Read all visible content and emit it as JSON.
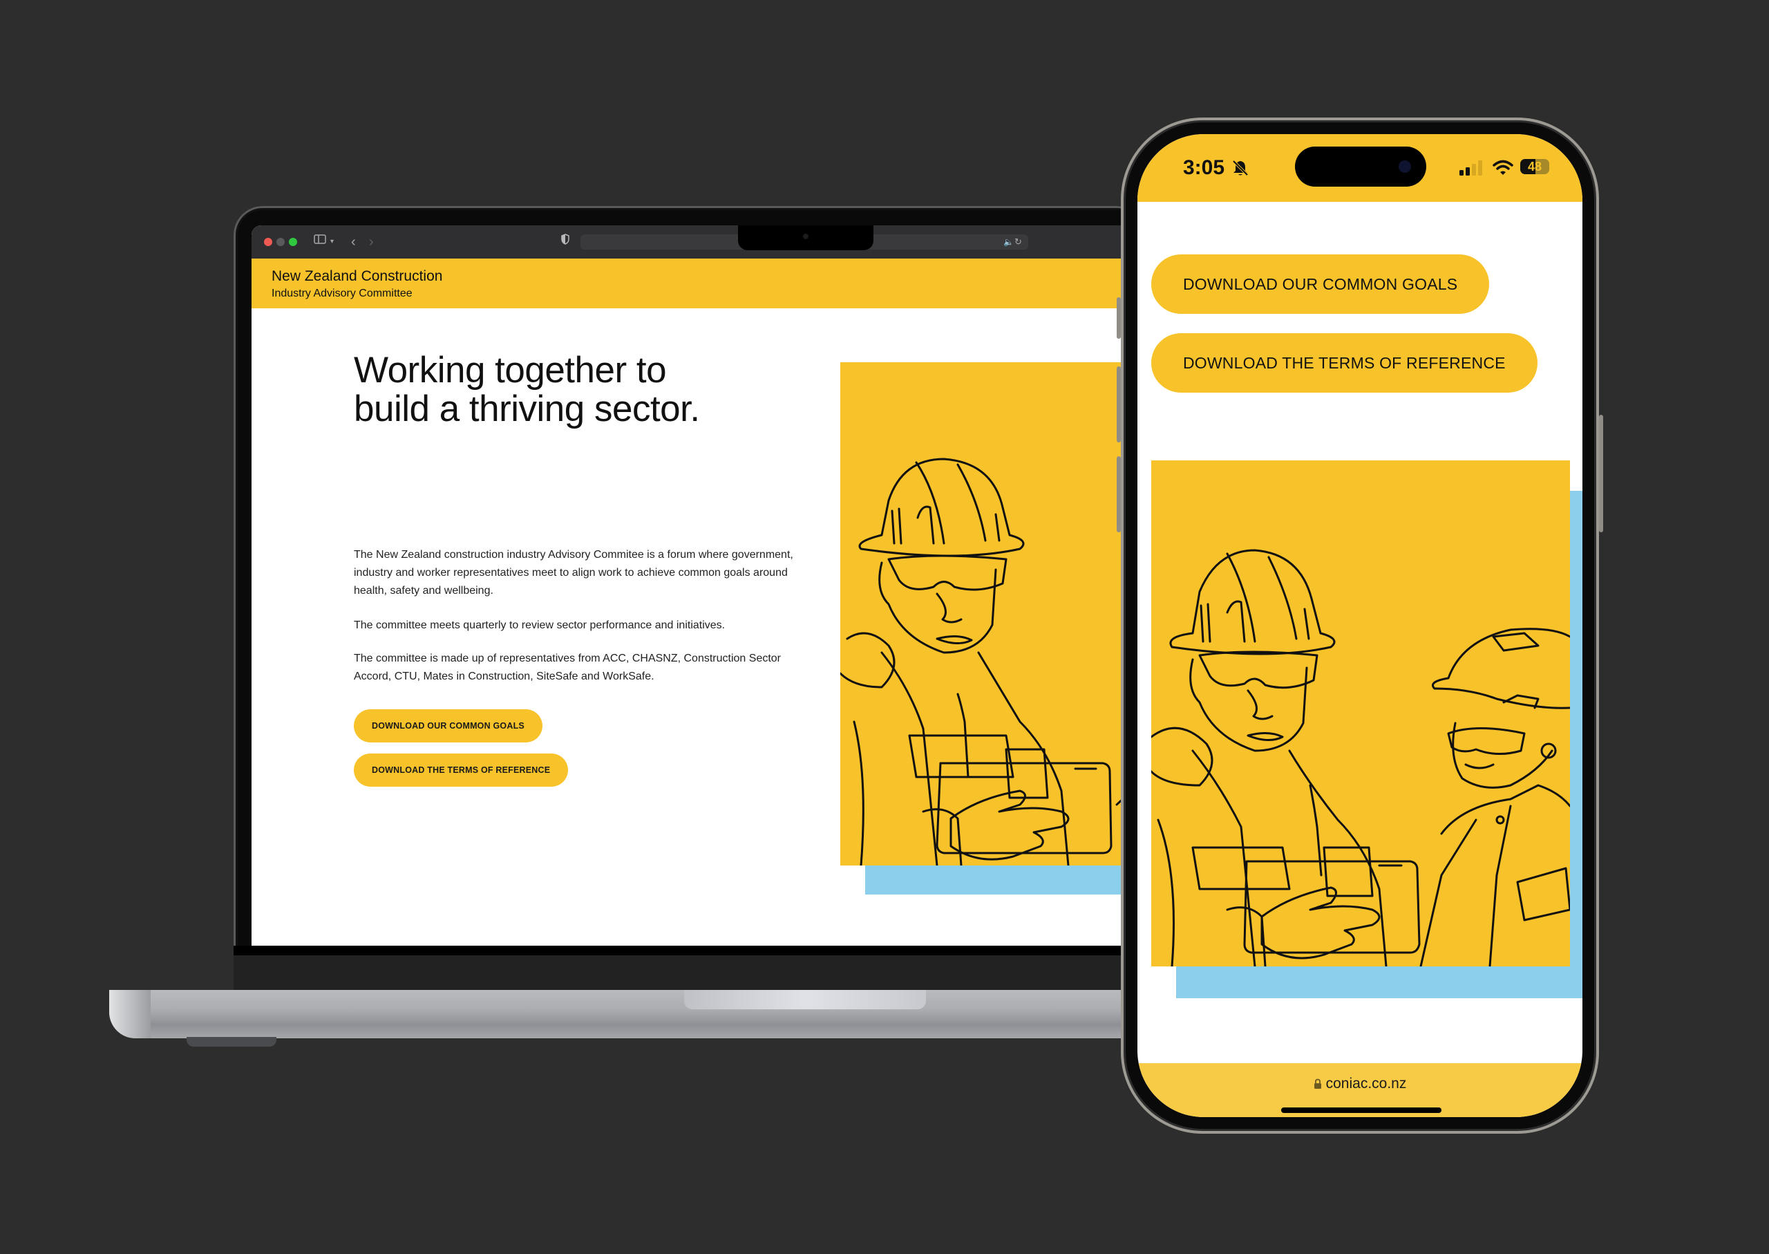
{
  "colors": {
    "brand_yellow": "#f7c22a",
    "accent_blue": "#8ccfec",
    "background": "#2d2d2d",
    "text": "#111111"
  },
  "laptop": {
    "browser": {
      "icons": [
        "close-dot",
        "minimize-dot",
        "zoom-dot",
        "sidebar-icon",
        "chevron-down-icon",
        "back-icon",
        "forward-icon",
        "shield-icon",
        "audio-icon",
        "reload-icon"
      ]
    },
    "header": {
      "title": "New Zealand Construction",
      "subtitle": "Industry Advisory Committee"
    },
    "hero": {
      "heading_line1": "Working together to",
      "heading_line2": "build a thriving sector.",
      "paragraphs": [
        "The New Zealand construction industry Advisory Commitee is a forum where government, industry and worker representatives meet to align work to achieve common goals around health, safety and wellbeing.",
        "The committee meets quarterly to review sector performance and initiatives.",
        "The committee is made up of representatives from ACC, CHASNZ, Construction Sector Accord, CTU, Mates in Construction, SiteSafe and WorkSafe."
      ],
      "buttons": [
        {
          "label": "DOWNLOAD OUR COMMON GOALS"
        },
        {
          "label": "DOWNLOAD THE TERMS OF REFERENCE"
        }
      ]
    },
    "illustration": "construction-workers-line-art"
  },
  "phone": {
    "status": {
      "time": "3:05",
      "battery": "48",
      "icons": [
        "silent-bell-icon",
        "signal-icon",
        "wifi-icon",
        "battery-icon"
      ]
    },
    "buttons": [
      {
        "label": "DOWNLOAD OUR COMMON GOALS"
      },
      {
        "label": "DOWNLOAD THE TERMS OF REFERENCE"
      }
    ],
    "illustration": "construction-workers-line-art",
    "address_bar": {
      "url": "coniac.co.nz"
    }
  }
}
